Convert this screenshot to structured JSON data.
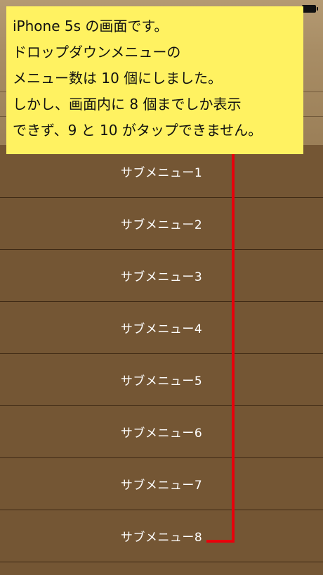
{
  "app_header": {
    "background": "#a88d65"
  },
  "annotation": {
    "background": "#fff261",
    "line_color": "#e8000b",
    "lines": [
      "iPhone 5s の画面です。",
      "ドロップダウンメニューの",
      "メニュー数は 10 個にしました。",
      "しかし、画面内に 8 個までしか表示",
      "できず、9 と 10 がタップできません。"
    ]
  },
  "dropdown_menu": {
    "background": "#745634",
    "divider_color": "#3f2a15",
    "items": [
      "サブメニュー1",
      "サブメニュー2",
      "サブメニュー3",
      "サブメニュー4",
      "サブメニュー5",
      "サブメニュー6",
      "サブメニュー7",
      "サブメニュー8"
    ]
  },
  "icons": {
    "battery": "battery-icon"
  }
}
